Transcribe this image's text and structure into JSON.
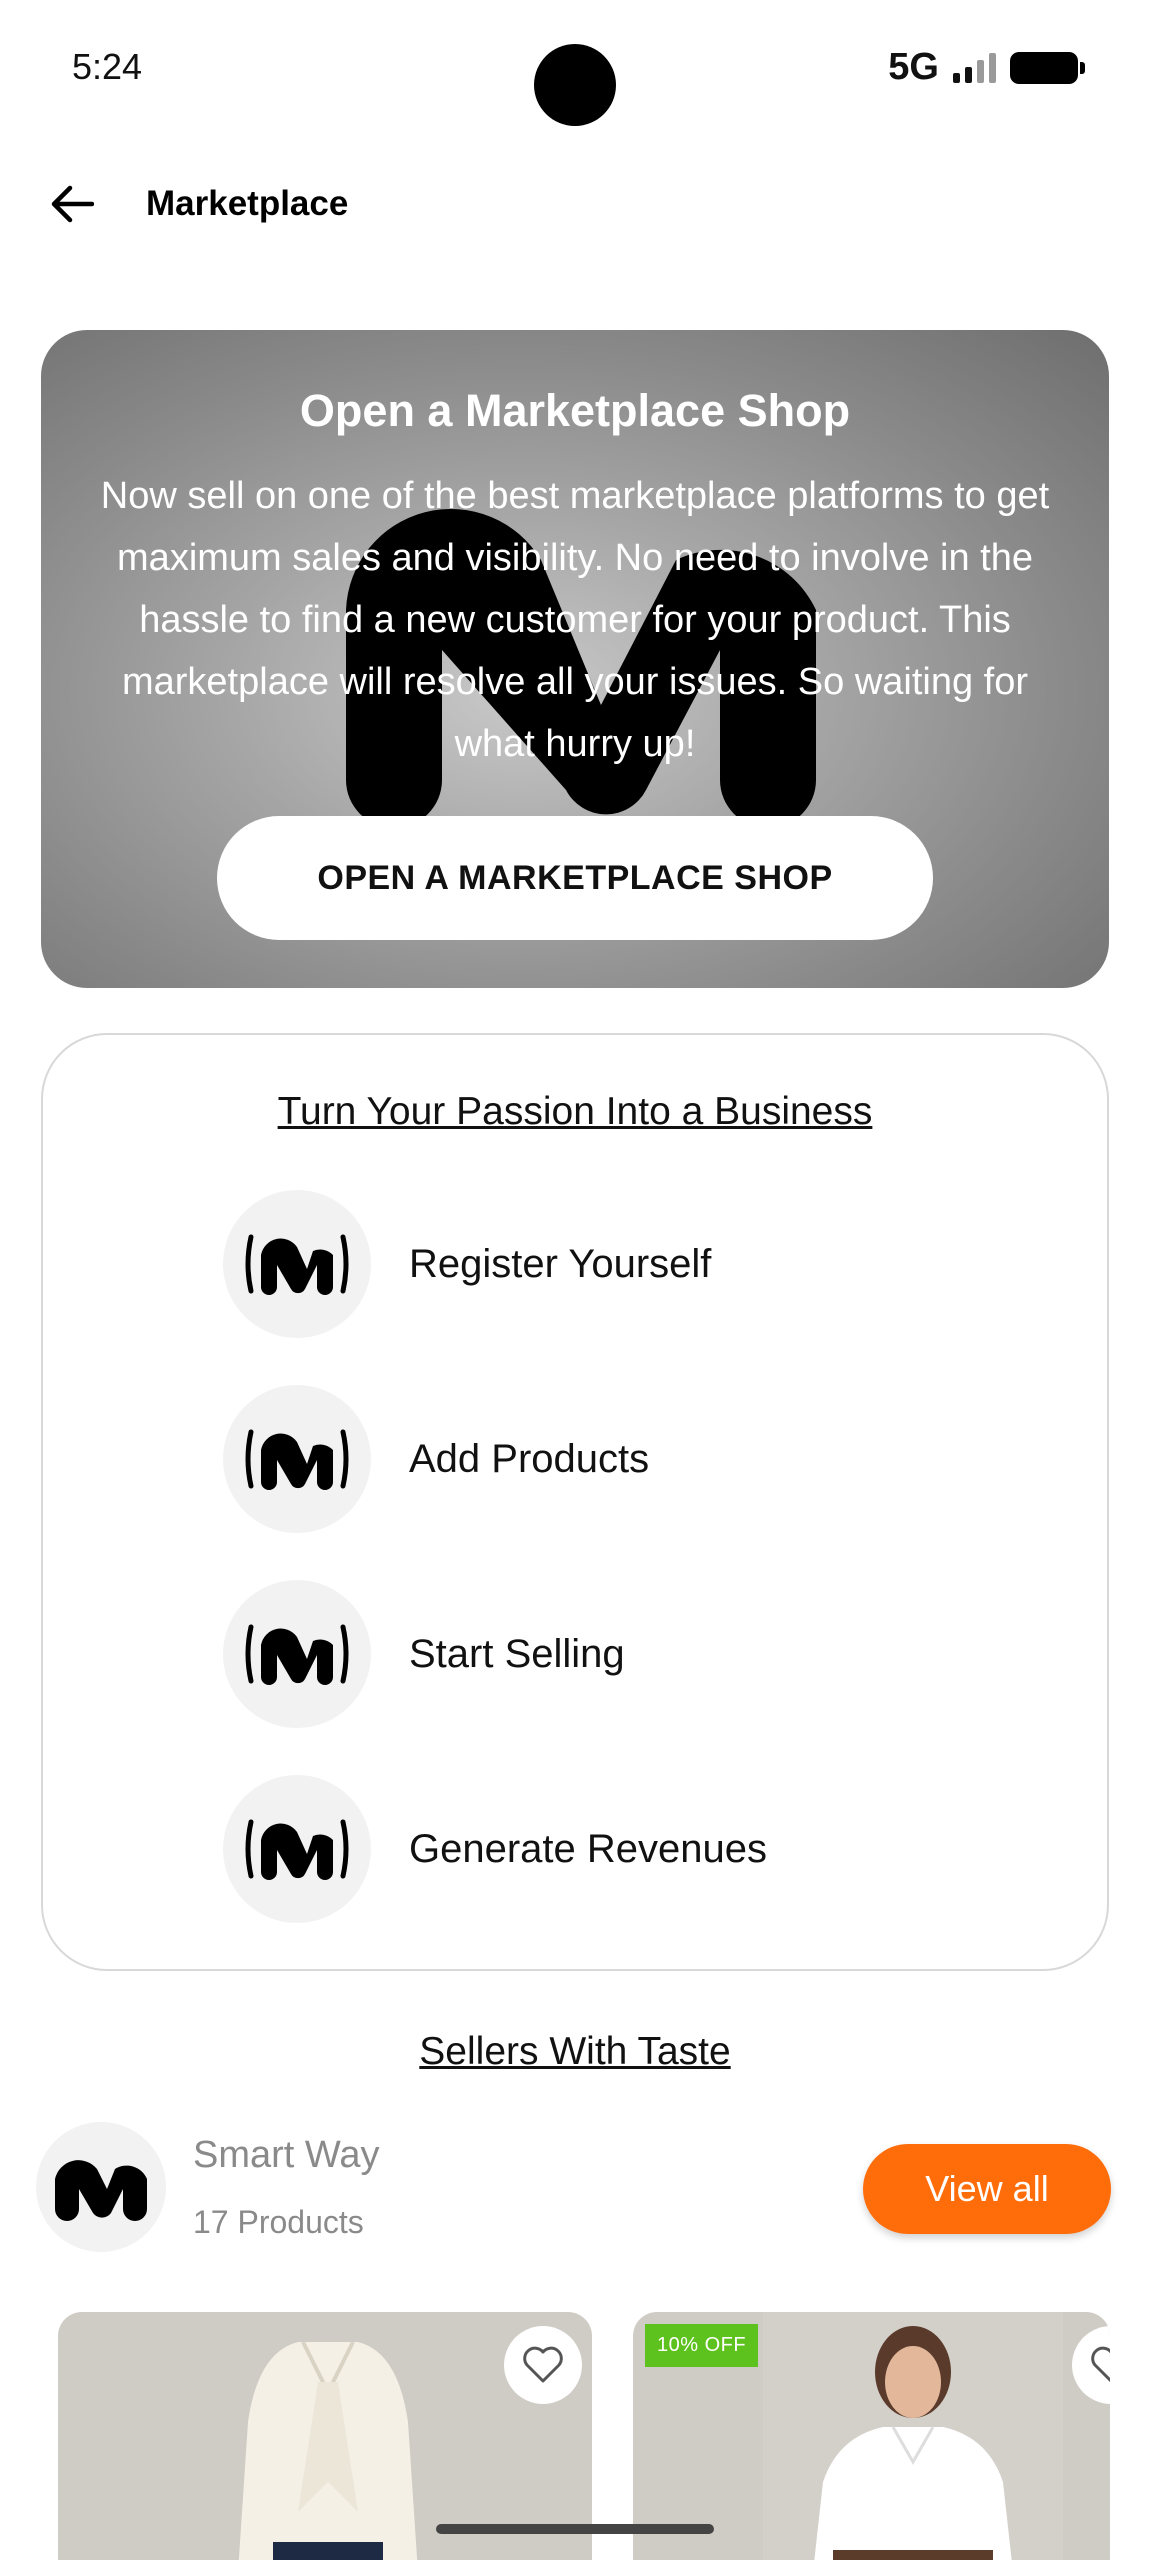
{
  "status_bar": {
    "time": "5:24",
    "network": "5G"
  },
  "app_bar": {
    "title": "Marketplace",
    "back_icon": "arrow-left-icon"
  },
  "hero": {
    "title": "Open a Marketplace Shop",
    "description": "Now sell on one of the best marketplace platforms to get maximum sales and visibility. No need to involve in the hassle to find a new customer for your product. This marketplace will resolve all your issues. So waiting for what hurry up!",
    "button_label": "OPEN A MARKETPLACE SHOP",
    "logo_icon": "marketplace-logo-icon"
  },
  "steps": {
    "heading": "Turn Your Passion Into a Business",
    "items": [
      {
        "label": "Register Yourself",
        "icon": "marketplace-logo-icon"
      },
      {
        "label": "Add Products",
        "icon": "marketplace-logo-icon"
      },
      {
        "label": "Start Selling",
        "icon": "marketplace-logo-icon"
      },
      {
        "label": "Generate Revenues",
        "icon": "marketplace-logo-icon"
      }
    ]
  },
  "sellers": {
    "heading": "Sellers With Taste",
    "seller": {
      "name": "Smart Way",
      "products_count": "17 Products",
      "view_all_label": "View all"
    },
    "accent_color": "#ff6d0a",
    "products": [
      {
        "badge": "",
        "favorite_icon": "heart-outline-icon"
      },
      {
        "badge": "10% OFF",
        "favorite_icon": "heart-outline-icon"
      }
    ],
    "badge_color": "#5dc21e"
  }
}
